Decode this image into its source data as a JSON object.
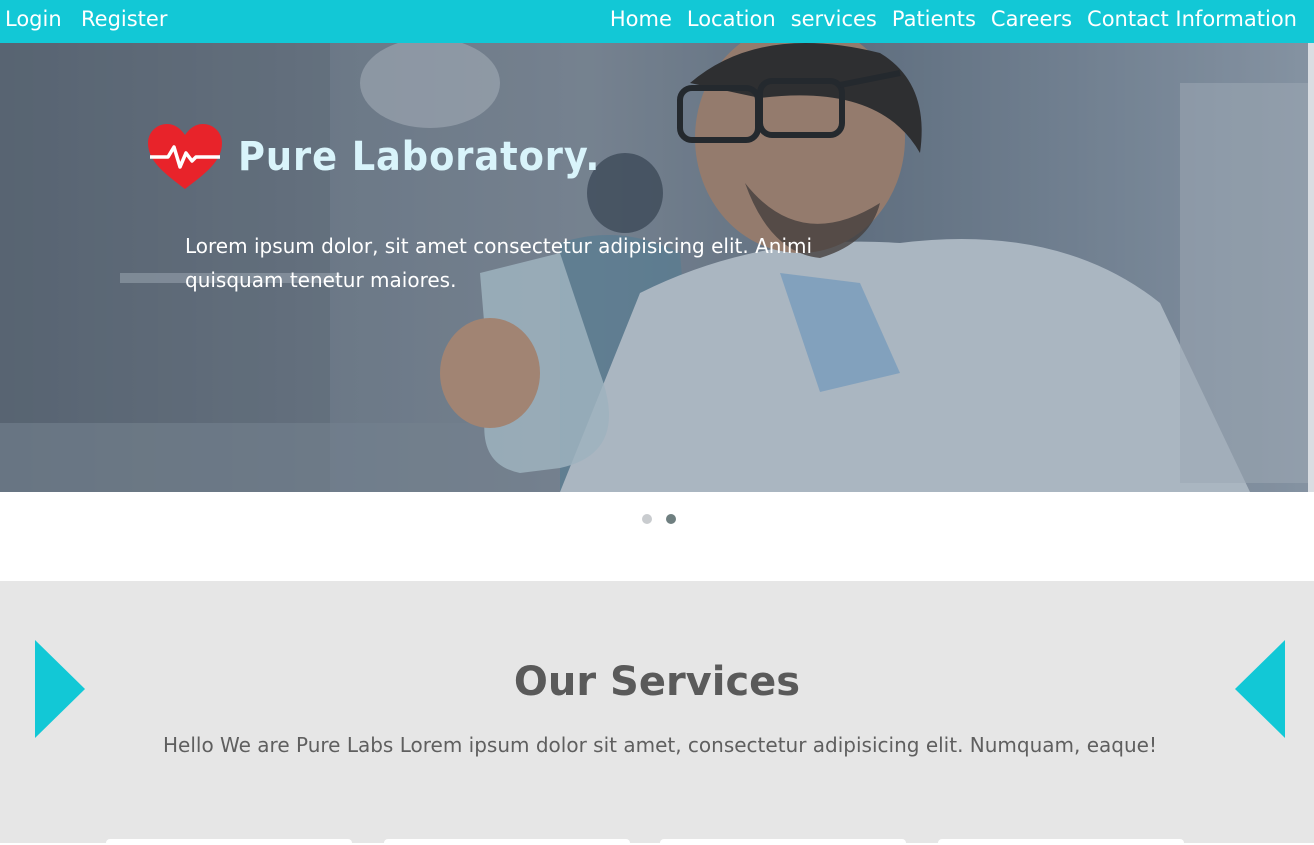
{
  "nav": {
    "left": [
      "Login",
      "Register"
    ],
    "right": [
      "Home",
      "Location",
      "services",
      "Patients",
      "Careers",
      "Contact Information"
    ]
  },
  "hero": {
    "title": "Pure Laboratory.",
    "text": "Lorem ipsum dolor, sit amet consectetur adipisicing elit. Animi quisquam tenetur maiores."
  },
  "carousel": {
    "slides": 2,
    "active_index": 1
  },
  "services": {
    "title": "Our Services",
    "subtitle": "Hello We are Pure Labs Lorem ipsum dolor sit amet, consectetur adipisicing elit. Numquam, eaque!"
  },
  "colors": {
    "accent": "#12c8d6",
    "heart": "#e8232a",
    "title_text": "#5a5a5a"
  },
  "icons": [
    "heart-pulse-icon",
    "arrow-left-icon",
    "arrow-right-icon"
  ]
}
